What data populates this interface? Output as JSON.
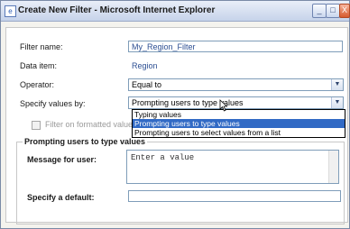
{
  "window": {
    "title": "Create New Filter - Microsoft Internet Explorer",
    "controls": {
      "minimize": "_",
      "maximize": "□",
      "close": "X"
    }
  },
  "form": {
    "filter_name_label": "Filter name:",
    "filter_name_value": "My_Region_Filter",
    "data_item_label": "Data item:",
    "data_item_value": "Region",
    "operator_label": "Operator:",
    "operator_value": "Equal to",
    "specify_values_label": "Specify values by:",
    "specify_values_value": "Prompting users to type values",
    "filter_formatted_label": "Filter on formatted values",
    "dropdown_options": [
      "Typing values",
      "Prompting users to type values",
      "Prompting users to select values from a list"
    ],
    "dropdown_selected_index": 1
  },
  "group": {
    "legend": "Prompting users to type values",
    "message_label": "Message for user:",
    "message_value": "Enter a value",
    "default_label": "Specify a default:",
    "default_value": ""
  },
  "icons": {
    "app": "ie-page-icon",
    "select_arrow": "chevron-down-icon",
    "cursor": "mouse-pointer-icon"
  }
}
